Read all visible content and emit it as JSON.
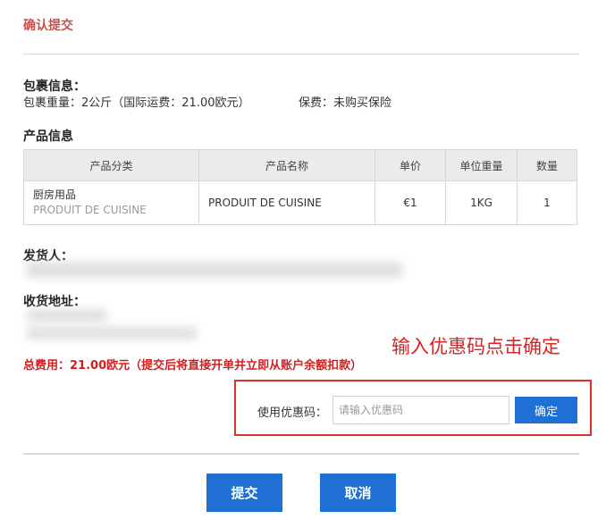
{
  "page": {
    "title": "确认提交"
  },
  "package": {
    "heading": "包裹信息：",
    "weight_text": "包裹重量：2公斤（国际运费：21.00欧元）",
    "insurance_text": "保费：未购买保险"
  },
  "products": {
    "heading": "产品信息",
    "columns": [
      "产品分类",
      "产品名称",
      "单价",
      "单位重量",
      "数量"
    ],
    "rows": [
      {
        "category": "厨房用品",
        "category_sub": "PRODUIT DE CUISINE",
        "name": "PRODUIT DE CUISINE",
        "unit_price": "€1",
        "unit_weight": "1KG",
        "quantity": "1"
      }
    ]
  },
  "sender": {
    "heading": "发货人："
  },
  "recipient": {
    "heading": "收货地址："
  },
  "total": {
    "text": "总费用：21.00欧元（提交后将直接开单并立即从账户余额扣款）"
  },
  "annotation": {
    "text": "输入优惠码点击确定"
  },
  "coupon": {
    "label": "使用优惠码：",
    "placeholder": "请输入优惠码",
    "value": "",
    "confirm_label": "确定"
  },
  "actions": {
    "submit_label": "提交",
    "cancel_label": "取消"
  },
  "colors": {
    "accent_blue": "#1f6fd4",
    "title_red": "#c9504b",
    "total_red": "#d11f1f",
    "annotation_red": "#e03030"
  }
}
